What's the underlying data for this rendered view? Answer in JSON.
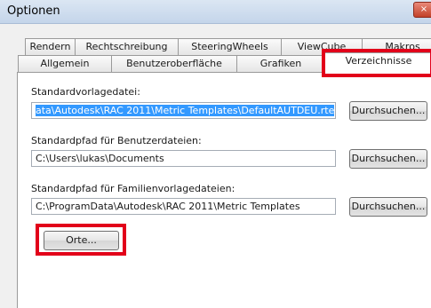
{
  "window": {
    "title": "Optionen",
    "close_symbol": "×"
  },
  "tabs": {
    "row1": [
      "Rendern",
      "Rechtschreibung",
      "SteeringWheels",
      "ViewCube",
      "Makros"
    ],
    "row2": [
      "Allgemein",
      "Benutzeroberfläche",
      "Grafiken",
      "Verzeichnisse"
    ],
    "active": "Verzeichnisse"
  },
  "settings": {
    "template_file": {
      "label": "Standardvorlagedatei:",
      "value": "ata\\Autodesk\\RAC 2011\\Metric Templates\\DefaultAUTDEU.rte",
      "browse_label": "Durchsuchen..."
    },
    "user_files_path": {
      "label": "Standardpfad für Benutzerdateien:",
      "value": "C:\\Users\\lukas\\Documents",
      "browse_label": "Durchsuchen..."
    },
    "family_templates_path": {
      "label": "Standardpfad für Familienvorlagedateien:",
      "value": "C:\\ProgramData\\Autodesk\\RAC 2011\\Metric Templates",
      "browse_label": "Durchsuchen..."
    },
    "places_button_label": "Orte..."
  },
  "colors": {
    "highlight_frame": "#e2001a",
    "selection": "#3399ff"
  }
}
